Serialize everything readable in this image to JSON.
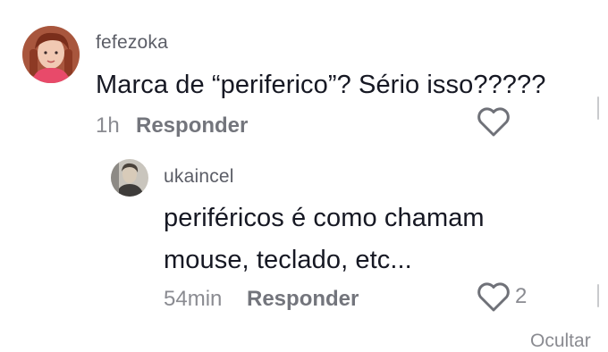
{
  "comments": [
    {
      "username": "fefezoka",
      "text": "Marca de “periferico”? Sério isso?????",
      "time": "1h",
      "reply_label": "Responder",
      "like_count": ""
    }
  ],
  "reply": {
    "username": "ukaincel",
    "text_line1": "periféricos é como chamam",
    "text_line2": "mouse, teclado, etc...",
    "time": "54min",
    "reply_label": "Responder",
    "like_count": "2"
  },
  "hide_label": "Ocultar",
  "icons": {
    "like": "heart-outline-icon"
  },
  "colors": {
    "text_primary": "#161823",
    "text_secondary": "#8a8b91",
    "background": "#ffffff"
  }
}
